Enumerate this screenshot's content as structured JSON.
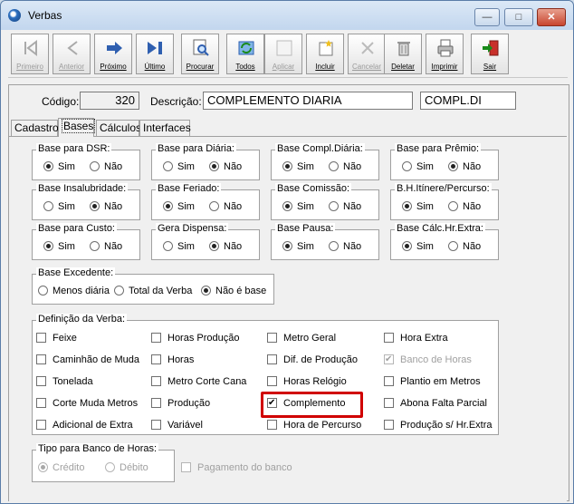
{
  "window": {
    "title": "Verbas",
    "min_label": "—",
    "max_label": "□",
    "close_label": "✕"
  },
  "toolbar": [
    {
      "label": "Primeiro",
      "icon": "first-icon",
      "enabled": false
    },
    {
      "label": "Anterior",
      "icon": "previous-icon",
      "enabled": false
    },
    {
      "label": "Próximo",
      "icon": "next-icon",
      "enabled": true
    },
    {
      "label": "Último",
      "icon": "last-icon",
      "enabled": true
    },
    {
      "label": "Procurar",
      "icon": "search-icon",
      "enabled": true
    },
    {
      "label": "Todos",
      "icon": "all-records-icon",
      "enabled": true
    },
    {
      "label": "Aplicar",
      "icon": "apply-icon",
      "enabled": false
    },
    {
      "label": "Incluir",
      "icon": "new-record-icon",
      "enabled": true
    },
    {
      "label": "Cancelar",
      "icon": "cancel-icon",
      "enabled": false
    },
    {
      "label": "Deletar",
      "icon": "trash-icon",
      "enabled": true
    },
    {
      "label": "Imprimir",
      "icon": "printer-icon",
      "enabled": true
    },
    {
      "label": "Sair",
      "icon": "exit-icon",
      "enabled": true
    }
  ],
  "header": {
    "codigo_label": "Código:",
    "codigo_value": "320",
    "descricao_label": "Descrição:",
    "descricao_value": "COMPLEMENTO DIARIA",
    "abrev_value": "COMPL.DI"
  },
  "tabs": [
    "Cadastro",
    "Bases",
    "Cálculos",
    "Interfaces"
  ],
  "active_tab": "Bases",
  "radio_groups": [
    {
      "title": "Base para DSR:",
      "opt1": "Sim",
      "opt2": "Não",
      "selected": 1
    },
    {
      "title": "Base para Diária:",
      "opt1": "Sim",
      "opt2": "Não",
      "selected": 2
    },
    {
      "title": "Base Compl.Diária:",
      "opt1": "Sim",
      "opt2": "Não",
      "selected": 1
    },
    {
      "title": "Base para Prêmio:",
      "opt1": "Sim",
      "opt2": "Não",
      "selected": 2
    },
    {
      "title": "Base Insalubridade:",
      "opt1": "Sim",
      "opt2": "Não",
      "selected": 2
    },
    {
      "title": "Base Feriado:",
      "opt1": "Sim",
      "opt2": "Não",
      "selected": 1
    },
    {
      "title": "Base Comissão:",
      "opt1": "Sim",
      "opt2": "Não",
      "selected": 1
    },
    {
      "title": "B.H.Itínere/Percurso:",
      "opt1": "Sim",
      "opt2": "Não",
      "selected": 1
    },
    {
      "title": "Base para Custo:",
      "opt1": "Sim",
      "opt2": "Não",
      "selected": 1
    },
    {
      "title": "Gera Dispensa:",
      "opt1": "Sim",
      "opt2": "Não",
      "selected": 2
    },
    {
      "title": "Base Pausa:",
      "opt1": "Sim",
      "opt2": "Não",
      "selected": 1
    },
    {
      "title": "Base Cálc.Hr.Extra:",
      "opt1": "Sim",
      "opt2": "Não",
      "selected": 1
    }
  ],
  "base_excedente": {
    "title": "Base Excedente:",
    "options": [
      "Menos diária",
      "Total da Verba",
      "Não é base"
    ],
    "selected": 2
  },
  "definicao": {
    "title": "Definição da Verba:",
    "items": [
      {
        "label": "Feixe",
        "checked": false,
        "disabled": false
      },
      {
        "label": "Horas Produção",
        "checked": false,
        "disabled": false
      },
      {
        "label": "Metro Geral",
        "checked": false,
        "disabled": false
      },
      {
        "label": "Hora Extra",
        "checked": false,
        "disabled": false
      },
      {
        "label": "Caminhão de Muda",
        "checked": false,
        "disabled": false
      },
      {
        "label": "Horas",
        "checked": false,
        "disabled": false
      },
      {
        "label": "Dif. de Produção",
        "checked": false,
        "disabled": false
      },
      {
        "label": "Banco de Horas",
        "checked": true,
        "disabled": true
      },
      {
        "label": "Tonelada",
        "checked": false,
        "disabled": false
      },
      {
        "label": "Metro Corte Cana",
        "checked": false,
        "disabled": false
      },
      {
        "label": "Horas Relógio",
        "checked": false,
        "disabled": false
      },
      {
        "label": "Plantio em Metros",
        "checked": false,
        "disabled": false
      },
      {
        "label": "Corte Muda Metros",
        "checked": false,
        "disabled": false
      },
      {
        "label": "Produção",
        "checked": false,
        "disabled": false
      },
      {
        "label": "Complemento",
        "checked": true,
        "disabled": false
      },
      {
        "label": "Abona Falta Parcial",
        "checked": false,
        "disabled": false
      },
      {
        "label": "Adicional de Extra",
        "checked": false,
        "disabled": false
      },
      {
        "label": "Variável",
        "checked": false,
        "disabled": false
      },
      {
        "label": "Hora de Percurso",
        "checked": false,
        "disabled": false
      },
      {
        "label": "Produção s/ Hr.Extra",
        "checked": false,
        "disabled": false
      }
    ]
  },
  "banco_horas": {
    "title": "Tipo para Banco de Horas:",
    "options": [
      "Crédito",
      "Débito"
    ],
    "selected": 1,
    "pagamento_label": "Pagamento do banco",
    "pagamento_checked": false
  },
  "colors": {
    "highlight": "#d00000",
    "arrow_blue": "#2f5fb0"
  }
}
